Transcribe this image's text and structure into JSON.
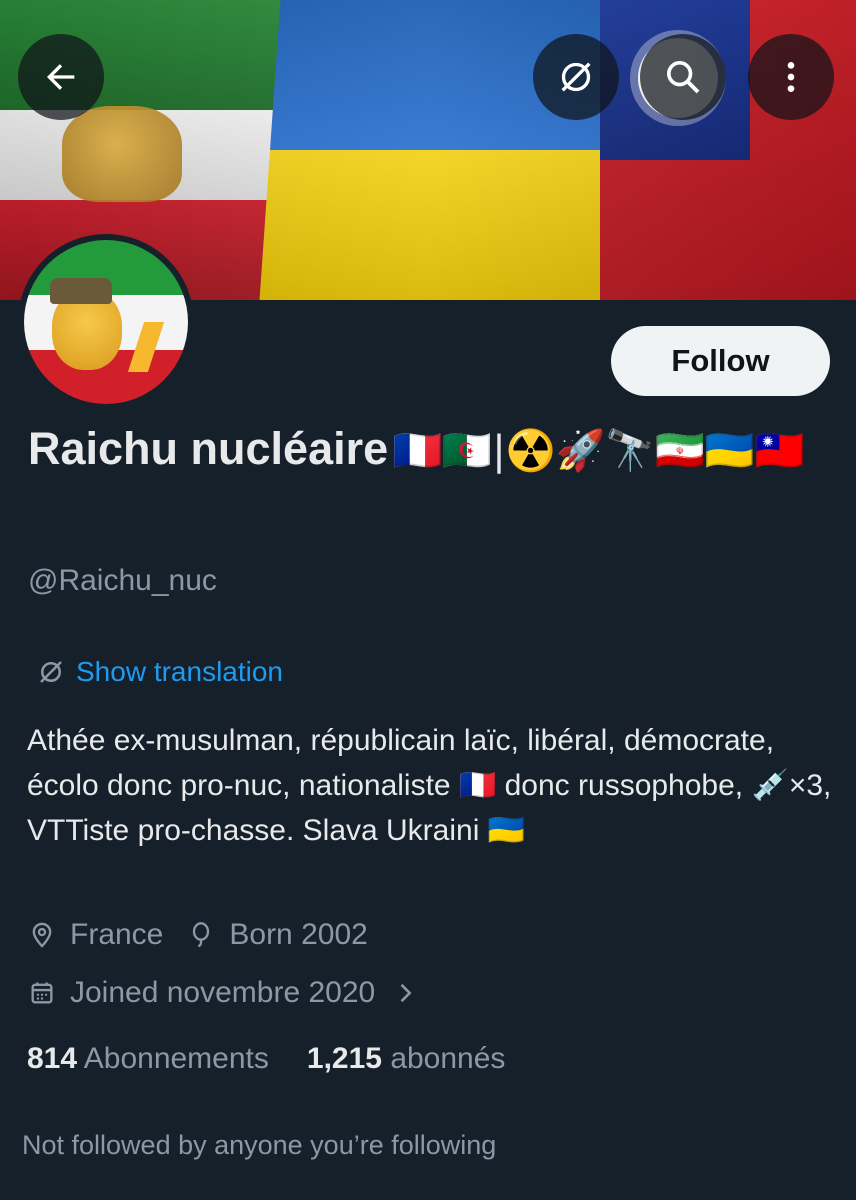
{
  "profile": {
    "display_name": "Raichu nucléaire",
    "name_emojis": "🇫🇷🇩🇿|☢️🚀🔭🇮🇷🇺🇦🇹🇼",
    "handle": "@Raichu_nuc",
    "follow_label": "Follow",
    "translate_label": "Show translation",
    "bio": "Athée ex-musulman, républicain laïc, libéral, démocrate, écolo donc pro-nuc, nationaliste 🇫🇷 donc russophobe, 💉×3, VTTiste pro-chasse. Slava Ukraini 🇺🇦",
    "location": "France",
    "born": "Born 2002",
    "joined": "Joined novembre 2020",
    "following_count": "814",
    "following_label": "Abonnements",
    "followers_count": "1,215",
    "followers_label": "abonnés",
    "not_followed_text": "Not followed by anyone you’re following"
  },
  "icons": {
    "back": "arrow-left-icon",
    "translate": "translate-icon",
    "search": "search-icon",
    "more": "more-vertical-icon",
    "location": "location-pin-icon",
    "born": "balloon-icon",
    "calendar": "calendar-icon",
    "chevron": "chevron-right-icon"
  },
  "colors": {
    "background": "#15202b",
    "text": "#e7e9ea",
    "secondary": "#8b98a5",
    "link": "#1d9bf0"
  }
}
